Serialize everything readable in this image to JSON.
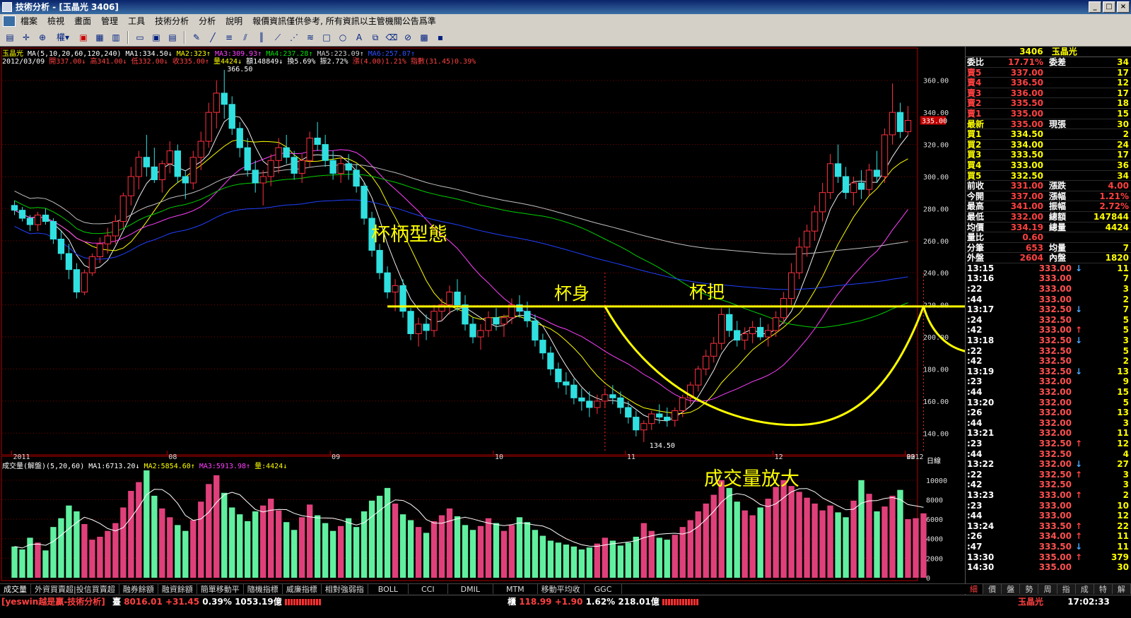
{
  "window": {
    "title": "技術分析 - [玉晶光 3406]",
    "controls": [
      "_",
      "□",
      "×"
    ]
  },
  "menu": [
    "檔案",
    "檢視",
    "畫面",
    "管理",
    "工具",
    "技術分析",
    "分析",
    "說明",
    "報價資訊僅供參考, 所有資訊以主管機關公告爲準"
  ],
  "toolbar": {
    "label": "權▾"
  },
  "header": {
    "line1_stock": "玉晶光",
    "line1_ma_params": "MA(5,10,20,60,120,240)",
    "ma1": "MA1:334.50↓",
    "ma2": "MA2:323↑",
    "ma3": "MA3:309.93↑",
    "ma4": "MA4:237.28↑",
    "ma5": "MA5:223.09↑",
    "ma6": "MA6:257.07↑",
    "line2_date": "2012/03/09",
    "open": "開337.00↓",
    "high": "高341.00↓",
    "low": "低332.00↓",
    "close": "收335.00↑",
    "vol": "量4424↓",
    "amount": "額148849↓",
    "turnover": "換5.69%",
    "amplitude": "振2.72%",
    "change": "漲(4.00)1.21%",
    "index": "指數(31.45)0.39%"
  },
  "price_axis": [
    "360.00",
    "340.00",
    "320.00",
    "300.00",
    "280.00",
    "260.00",
    "240.00",
    "220.00",
    "200.00",
    "180.00",
    "160.00",
    "140.00"
  ],
  "current_price_tag": "335.00",
  "high_label": "366.50",
  "low_label": "134.50",
  "time_axis": [
    "2011",
    "08",
    "09",
    "10",
    "11",
    "12",
    "2012",
    "02",
    "03"
  ],
  "time_unit": "日線",
  "volume_header": {
    "title": "成交量(解盤)(5,20,60)",
    "ma1": "MA1:6713.20↓",
    "ma2": "MA2:5854.60↑",
    "ma3": "MA3:5913.98↑",
    "vol": "量:4424↓"
  },
  "volume_axis": [
    "10000",
    "8000",
    "6000",
    "4000",
    "2000",
    "0"
  ],
  "annotations": {
    "pattern": "杯柄型態",
    "cup": "杯身",
    "handle": "杯把",
    "volume": "成交量放大"
  },
  "bottom_tabs": [
    "成交量",
    "外資買賣超|投信買賣超",
    "融券餘額",
    "融資餘額",
    "簡單移動平",
    "隨機指標",
    "威廉指標",
    "相對強弱指",
    "BOLL",
    "CCI",
    "DMIL",
    "MTM",
    "移動平均收",
    "GGC"
  ],
  "quote": {
    "title_code": "3406",
    "title_name": "玉晶光",
    "book": [
      {
        "l1": "委比",
        "v1": "17.71%",
        "l2": "委差",
        "v2": "34"
      },
      {
        "l1": "賣5",
        "v1": "337.00",
        "l2": "",
        "v2": "17"
      },
      {
        "l1": "賣4",
        "v1": "336.50",
        "l2": "",
        "v2": "12"
      },
      {
        "l1": "賣3",
        "v1": "336.00",
        "l2": "",
        "v2": "17"
      },
      {
        "l1": "賣2",
        "v1": "335.50",
        "l2": "",
        "v2": "18"
      },
      {
        "l1": "賣1",
        "v1": "335.00",
        "l2": "",
        "v2": "15"
      },
      {
        "l1": "最新",
        "v1": "335.00",
        "l2": "現張",
        "v2": "30"
      },
      {
        "l1": "買1",
        "v1": "334.50",
        "l2": "",
        "v2": "2"
      },
      {
        "l1": "買2",
        "v1": "334.00",
        "l2": "",
        "v2": "24"
      },
      {
        "l1": "買3",
        "v1": "333.50",
        "l2": "",
        "v2": "17"
      },
      {
        "l1": "買4",
        "v1": "333.00",
        "l2": "",
        "v2": "36"
      },
      {
        "l1": "買5",
        "v1": "332.50",
        "l2": "",
        "v2": "34"
      },
      {
        "l1": "前收",
        "v1": "331.00",
        "l2": "漲跌",
        "v2": "4.00"
      },
      {
        "l1": "今開",
        "v1": "337.00",
        "l2": "漲幅",
        "v2": "1.21%"
      },
      {
        "l1": "最高",
        "v1": "341.00",
        "l2": "振幅",
        "v2": "2.72%"
      },
      {
        "l1": "最低",
        "v1": "332.00",
        "l2": "總額",
        "v2": "147844"
      },
      {
        "l1": "均價",
        "v1": "334.19",
        "l2": "總量",
        "v2": "4424"
      },
      {
        "l1": "量比",
        "v1": "0.60",
        "l2": "",
        "v2": ""
      },
      {
        "l1": "分筆",
        "v1": "653",
        "l2": "均量",
        "v2": "7"
      },
      {
        "l1": "外盤",
        "v1": "2604",
        "l2": "內盤",
        "v2": "1820"
      }
    ],
    "ticks": [
      {
        "t": "13:15",
        "p": "333.00",
        "a": "↓",
        "q": "11"
      },
      {
        "t": "13:16",
        "p": "333.00",
        "a": "",
        "q": "7"
      },
      {
        "t": ":22",
        "p": "333.00",
        "a": "",
        "q": "3"
      },
      {
        "t": ":44",
        "p": "333.00",
        "a": "",
        "q": "2"
      },
      {
        "t": "13:17",
        "p": "332.50",
        "a": "↓",
        "q": "7"
      },
      {
        "t": ":24",
        "p": "332.50",
        "a": "",
        "q": "5"
      },
      {
        "t": ":42",
        "p": "333.00",
        "a": "↑",
        "q": "5"
      },
      {
        "t": "13:18",
        "p": "332.50",
        "a": "↓",
        "q": "3"
      },
      {
        "t": ":22",
        "p": "332.50",
        "a": "",
        "q": "5"
      },
      {
        "t": ":42",
        "p": "332.50",
        "a": "",
        "q": "2"
      },
      {
        "t": "13:19",
        "p": "332.50",
        "a": "↓",
        "q": "13"
      },
      {
        "t": ":23",
        "p": "332.00",
        "a": "",
        "q": "9"
      },
      {
        "t": ":44",
        "p": "332.00",
        "a": "",
        "q": "15"
      },
      {
        "t": "13:20",
        "p": "332.00",
        "a": "",
        "q": "5"
      },
      {
        "t": ":26",
        "p": "332.00",
        "a": "",
        "q": "13"
      },
      {
        "t": ":44",
        "p": "332.00",
        "a": "",
        "q": "3"
      },
      {
        "t": "13:21",
        "p": "332.00",
        "a": "",
        "q": "11"
      },
      {
        "t": ":23",
        "p": "332.50",
        "a": "↑",
        "q": "12"
      },
      {
        "t": ":44",
        "p": "332.50",
        "a": "",
        "q": "4"
      },
      {
        "t": "13:22",
        "p": "332.00",
        "a": "↓",
        "q": "27"
      },
      {
        "t": ":22",
        "p": "332.50",
        "a": "↑",
        "q": "3"
      },
      {
        "t": ":42",
        "p": "332.50",
        "a": "",
        "q": "3"
      },
      {
        "t": "13:23",
        "p": "333.00",
        "a": "↑",
        "q": "2"
      },
      {
        "t": ":23",
        "p": "333.00",
        "a": "",
        "q": "10"
      },
      {
        "t": ":44",
        "p": "333.00",
        "a": "",
        "q": "12"
      },
      {
        "t": "13:24",
        "p": "333.50",
        "a": "↑",
        "q": "22"
      },
      {
        "t": ":26",
        "p": "334.00",
        "a": "↑",
        "q": "11"
      },
      {
        "t": ":47",
        "p": "333.50",
        "a": "↓",
        "q": "11"
      },
      {
        "t": "13:30",
        "p": "335.00",
        "a": "↑",
        "q": "379"
      },
      {
        "t": "14:30",
        "p": "335.00",
        "a": "",
        "q": "30"
      }
    ],
    "tabs": [
      "細",
      "價",
      "盤",
      "勢",
      "周",
      "指",
      "成",
      "特",
      "解"
    ]
  },
  "status": {
    "brand": "[yeswin越是贏-技術分析]",
    "twse_label": "臺",
    "twse_index": "8016.01",
    "twse_change": "+31.45",
    "twse_pct": "0.39%",
    "twse_amount": "1053.19億",
    "otc_label": "櫃",
    "otc_index": "118.99",
    "otc_change": "+1.90",
    "otc_pct": "1.62%",
    "otc_amount": "218.01億",
    "stock": "玉晶光",
    "clock": "17:02:33"
  },
  "chart_data": {
    "type": "candlestick",
    "price_range": [
      130,
      370
    ],
    "volume_range": [
      0,
      11000
    ],
    "candles": [
      [
        282,
        285,
        276,
        279
      ],
      [
        279,
        281,
        272,
        274
      ],
      [
        274,
        276,
        266,
        270
      ],
      [
        270,
        278,
        266,
        276
      ],
      [
        276,
        280,
        270,
        272
      ],
      [
        272,
        274,
        258,
        261
      ],
      [
        261,
        266,
        248,
        252
      ],
      [
        252,
        258,
        236,
        242
      ],
      [
        242,
        246,
        224,
        228
      ],
      [
        228,
        242,
        226,
        240
      ],
      [
        240,
        252,
        238,
        250
      ],
      [
        250,
        262,
        246,
        258
      ],
      [
        258,
        268,
        252,
        263
      ],
      [
        263,
        276,
        258,
        272
      ],
      [
        272,
        290,
        268,
        288
      ],
      [
        288,
        306,
        282,
        300
      ],
      [
        300,
        316,
        292,
        312
      ],
      [
        312,
        326,
        300,
        306
      ],
      [
        306,
        318,
        296,
        298
      ],
      [
        298,
        310,
        290,
        308
      ],
      [
        308,
        322,
        302,
        316
      ],
      [
        316,
        320,
        296,
        300
      ],
      [
        300,
        304,
        286,
        296
      ],
      [
        296,
        316,
        292,
        312
      ],
      [
        312,
        328,
        304,
        322
      ],
      [
        322,
        346,
        318,
        340
      ],
      [
        340,
        360,
        330,
        352
      ],
      [
        352,
        366.5,
        336,
        345
      ],
      [
        345,
        350,
        326,
        330
      ],
      [
        330,
        334,
        312,
        318
      ],
      [
        318,
        324,
        300,
        304
      ],
      [
        304,
        310,
        290,
        296
      ],
      [
        296,
        304,
        282,
        300
      ],
      [
        300,
        314,
        294,
        310
      ],
      [
        310,
        324,
        302,
        318
      ],
      [
        318,
        326,
        308,
        312
      ],
      [
        312,
        316,
        298,
        302
      ],
      [
        302,
        314,
        296,
        310
      ],
      [
        310,
        328,
        306,
        324
      ],
      [
        324,
        334,
        316,
        320
      ],
      [
        320,
        326,
        306,
        310
      ],
      [
        310,
        316,
        298,
        302
      ],
      [
        302,
        312,
        296,
        308
      ],
      [
        308,
        314,
        298,
        304
      ],
      [
        304,
        308,
        290,
        294
      ],
      [
        294,
        296,
        270,
        274
      ],
      [
        274,
        278,
        250,
        254
      ],
      [
        254,
        258,
        236,
        240
      ],
      [
        240,
        244,
        224,
        228
      ],
      [
        228,
        236,
        216,
        232
      ],
      [
        232,
        236,
        212,
        216
      ],
      [
        216,
        218,
        198,
        202
      ],
      [
        202,
        212,
        194,
        208
      ],
      [
        208,
        214,
        198,
        204
      ],
      [
        204,
        220,
        200,
        216
      ],
      [
        216,
        224,
        210,
        220
      ],
      [
        220,
        232,
        214,
        228
      ],
      [
        228,
        236,
        216,
        220
      ],
      [
        220,
        226,
        204,
        208
      ],
      [
        208,
        212,
        196,
        200
      ],
      [
        200,
        208,
        192,
        204
      ],
      [
        204,
        216,
        200,
        212
      ],
      [
        212,
        218,
        204,
        208
      ],
      [
        208,
        214,
        200,
        212
      ],
      [
        212,
        224,
        208,
        220
      ],
      [
        220,
        226,
        212,
        216
      ],
      [
        216,
        222,
        206,
        210
      ],
      [
        210,
        214,
        194,
        198
      ],
      [
        198,
        202,
        186,
        190
      ],
      [
        190,
        194,
        176,
        180
      ],
      [
        180,
        184,
        168,
        172
      ],
      [
        172,
        178,
        164,
        170
      ],
      [
        170,
        174,
        158,
        162
      ],
      [
        162,
        168,
        154,
        160
      ],
      [
        160,
        166,
        150,
        156
      ],
      [
        156,
        164,
        152,
        160
      ],
      [
        160,
        168,
        156,
        164
      ],
      [
        164,
        170,
        158,
        162
      ],
      [
        162,
        166,
        152,
        156
      ],
      [
        156,
        160,
        146,
        150
      ],
      [
        150,
        154,
        138,
        142
      ],
      [
        142,
        148,
        134.5,
        146
      ],
      [
        146,
        154,
        142,
        152
      ],
      [
        152,
        158,
        146,
        150
      ],
      [
        150,
        156,
        144,
        148
      ],
      [
        148,
        156,
        144,
        154
      ],
      [
        154,
        164,
        150,
        162
      ],
      [
        162,
        172,
        158,
        170
      ],
      [
        170,
        182,
        166,
        180
      ],
      [
        180,
        192,
        176,
        188
      ],
      [
        188,
        200,
        184,
        196
      ],
      [
        196,
        218,
        192,
        214
      ],
      [
        214,
        218,
        200,
        204
      ],
      [
        204,
        210,
        194,
        198
      ],
      [
        198,
        206,
        192,
        202
      ],
      [
        202,
        210,
        196,
        206
      ],
      [
        206,
        212,
        198,
        200
      ],
      [
        200,
        208,
        194,
        204
      ],
      [
        204,
        216,
        200,
        212
      ],
      [
        212,
        228,
        208,
        224
      ],
      [
        224,
        246,
        220,
        240
      ],
      [
        240,
        262,
        236,
        256
      ],
      [
        256,
        270,
        250,
        266
      ],
      [
        266,
        282,
        260,
        278
      ],
      [
        278,
        296,
        272,
        290
      ],
      [
        290,
        314,
        286,
        308
      ],
      [
        308,
        320,
        296,
        300
      ],
      [
        300,
        306,
        286,
        290
      ],
      [
        290,
        300,
        282,
        296
      ],
      [
        296,
        304,
        286,
        292
      ],
      [
        292,
        308,
        288,
        304
      ],
      [
        304,
        316,
        296,
        300
      ],
      [
        300,
        330,
        296,
        326
      ],
      [
        326,
        358,
        320,
        340
      ],
      [
        340,
        346,
        324,
        328
      ],
      [
        328,
        344,
        326,
        335
      ]
    ],
    "volume": [
      3200,
      2900,
      4100,
      3600,
      2800,
      5200,
      6100,
      7400,
      6800,
      5500,
      3900,
      4200,
      4800,
      5600,
      7200,
      8900,
      9800,
      11000,
      8400,
      7100,
      6200,
      5400,
      4800,
      5900,
      7800,
      9600,
      10500,
      8700,
      7200,
      6500,
      5800,
      6800,
      7400,
      8100,
      6900,
      5700,
      4900,
      6200,
      7500,
      6400,
      5600,
      4800,
      5300,
      6100,
      5200,
      6800,
      7900,
      8400,
      9200,
      7600,
      6500,
      5900,
      5200,
      4600,
      5800,
      6400,
      7100,
      6300,
      5400,
      4900,
      5300,
      6100,
      5600,
      4800,
      5400,
      6200,
      5700,
      4900,
      4300,
      3800,
      3600,
      3400,
      3200,
      2900,
      3100,
      3500,
      4100,
      3800,
      3300,
      3600,
      4200,
      5600,
      4800,
      4100,
      3900,
      4400,
      5200,
      5900,
      6800,
      7600,
      8500,
      10000,
      9200,
      7800,
      6900,
      6400,
      7200,
      8100,
      9300,
      10000,
      9400,
      8800,
      8200,
      7600,
      6900,
      7400,
      6700,
      6200,
      7900,
      10000,
      8600,
      6800,
      7300,
      8400,
      9000,
      6000,
      6100,
      6600
    ]
  }
}
